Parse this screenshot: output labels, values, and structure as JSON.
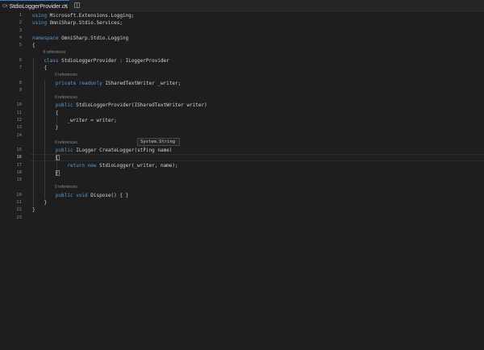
{
  "tab": {
    "icon_label": "C#",
    "title": "StdioLoggerProvider.cs",
    "close_glyph": "×"
  },
  "codelens": "0 references",
  "lines": [
    {
      "n": "1",
      "parts": [
        [
          "kw",
          "using"
        ],
        [
          "txt",
          " Microsoft.Extensions.Logging;"
        ]
      ]
    },
    {
      "n": "2",
      "parts": [
        [
          "kw",
          "using"
        ],
        [
          "txt",
          " OmniSharp.Stdio.Services;"
        ]
      ]
    },
    {
      "n": "3",
      "parts": []
    },
    {
      "n": "4",
      "parts": [
        [
          "kw",
          "namespace"
        ],
        [
          "txt",
          " OmniSharp.Stdio.Logging"
        ]
      ]
    },
    {
      "n": "5",
      "parts": [
        [
          "txt",
          "{"
        ]
      ]
    },
    {
      "n": "6",
      "lens": true,
      "lens_indent": 4,
      "parts": [
        [
          "txt",
          "    "
        ],
        [
          "kw",
          "class"
        ],
        [
          "txt",
          " StdioLoggerProvider : ILoggerProvider"
        ]
      ]
    },
    {
      "n": "7",
      "parts": [
        [
          "txt",
          "    {"
        ]
      ]
    },
    {
      "n": "8",
      "lens": true,
      "lens_indent": 8,
      "parts": [
        [
          "txt",
          "        "
        ],
        [
          "kw",
          "private readonly"
        ],
        [
          "txt",
          " ISharedTextWriter _writer;"
        ]
      ]
    },
    {
      "n": "9",
      "parts": []
    },
    {
      "n": "10",
      "lens": true,
      "lens_indent": 8,
      "parts": [
        [
          "txt",
          "        "
        ],
        [
          "kw",
          "public"
        ],
        [
          "txt",
          " StdioLoggerProvider(ISharedTextWriter writer)"
        ]
      ]
    },
    {
      "n": "11",
      "parts": [
        [
          "txt",
          "        {"
        ]
      ]
    },
    {
      "n": "12",
      "parts": [
        [
          "txt",
          "            _writer = writer;"
        ]
      ]
    },
    {
      "n": "13",
      "parts": [
        [
          "txt",
          "        }"
        ]
      ]
    },
    {
      "n": "14",
      "parts": []
    },
    {
      "n": "15",
      "lens": true,
      "lens_indent": 8,
      "parts": [
        [
          "txt",
          "        "
        ],
        [
          "kw",
          "public"
        ],
        [
          "txt",
          " ILogger CreateLogger(string name)"
        ]
      ]
    },
    {
      "n": "16",
      "active": true,
      "parts": [
        [
          "txt",
          "        {"
        ]
      ]
    },
    {
      "n": "17",
      "parts": [
        [
          "txt",
          "            "
        ],
        [
          "kw",
          "return new"
        ],
        [
          "txt",
          " StdioLogger(_writer, name);"
        ]
      ]
    },
    {
      "n": "18",
      "parts": [
        [
          "txt",
          "        }"
        ]
      ]
    },
    {
      "n": "19",
      "parts": []
    },
    {
      "n": "20",
      "lens": true,
      "lens_indent": 8,
      "parts": [
        [
          "txt",
          "        "
        ],
        [
          "kw",
          "public void"
        ],
        [
          "txt",
          " Dispose() { }"
        ]
      ]
    },
    {
      "n": "21",
      "parts": [
        [
          "txt",
          "    }"
        ]
      ]
    },
    {
      "n": "22",
      "parts": [
        [
          "txt",
          "}"
        ]
      ]
    },
    {
      "n": "23",
      "parts": []
    }
  ],
  "hover": {
    "text": "System.String"
  },
  "colors": {
    "background": "#1e1e1e",
    "keyword": "#569cd6",
    "text": "#d4d4d4",
    "line_number": "#858585",
    "codelens": "#8a8a8a",
    "tab_accent": "#2f7fd4"
  }
}
